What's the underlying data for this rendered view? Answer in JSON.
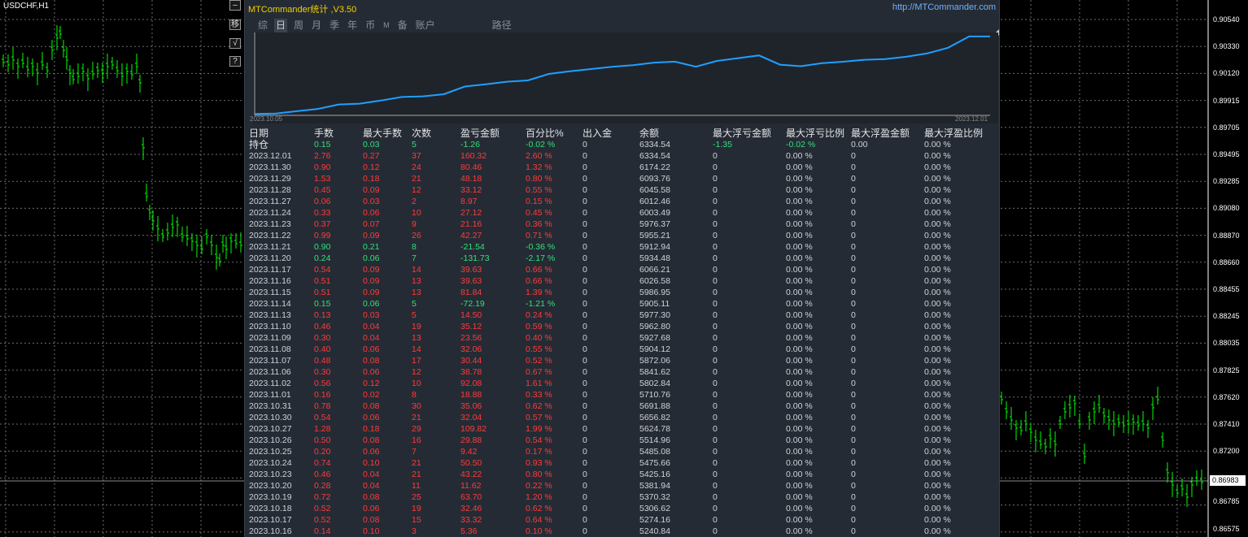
{
  "chart": {
    "symbol": "USDCHF,H1",
    "price_labels": [
      "0.90540",
      "0.90330",
      "0.90120",
      "0.89915",
      "0.89705",
      "0.89495",
      "0.89285",
      "0.89080",
      "0.88870",
      "0.88660",
      "0.88455",
      "0.88245",
      "0.88035",
      "0.87825",
      "0.87620",
      "0.87410",
      "0.87200",
      "0.86983",
      "0.86785",
      "0.86575"
    ],
    "current_price": "0.86983",
    "candle_color": "#00ff00"
  },
  "side_buttons": [
    "–",
    "移",
    "√",
    "?"
  ],
  "panel": {
    "title": "MTCommander统计 ,V3.50",
    "url": "http://MTCommander.com",
    "tabs": [
      {
        "label": "综",
        "active": false
      },
      {
        "label": "日",
        "active": true
      },
      {
        "label": "周",
        "active": false
      },
      {
        "label": "月",
        "active": false
      },
      {
        "label": "季",
        "active": false
      },
      {
        "label": "年",
        "active": false
      },
      {
        "label": "币",
        "active": false
      },
      {
        "label": "M",
        "active": false
      },
      {
        "label": "备",
        "active": false
      },
      {
        "label": "账户",
        "active": false
      },
      {
        "label": "路径",
        "active": false
      }
    ],
    "equity_chart": {
      "start_label": "2023.10.05",
      "end_label": "2023.12.01",
      "line_color": "#1ea0ff"
    },
    "headers": [
      "日期",
      "手数",
      "最大手数",
      "次数",
      "盈亏金额",
      "百分比%",
      "出入金",
      "余额",
      "最大浮亏金额",
      "最大浮亏比例",
      "最大浮盈金额",
      "最大浮盈比例"
    ],
    "holding": {
      "label": "持仓",
      "lots": "0.15",
      "max_lots": "0.03",
      "count": "5",
      "pnl": "-1.26",
      "pct": "-0.02 %",
      "deposit": "0",
      "balance": "6334.54",
      "max_float_loss": "-1.35",
      "max_float_loss_pct": "-0.02 %",
      "max_float_profit": "0.00",
      "max_float_profit_pct": "0.00 %"
    },
    "rows": [
      {
        "date": "2023.12.01",
        "lots": "2.76",
        "max_lots": "0.27",
        "count": "37",
        "pnl": "160.32",
        "pct": "2.60 %",
        "deposit": "0",
        "balance": "6334.54",
        "fl": "0",
        "flp": "0.00 %",
        "fp": "0",
        "fpp": "0.00 %",
        "neg": false
      },
      {
        "date": "2023.11.30",
        "lots": "0.90",
        "max_lots": "0.12",
        "count": "24",
        "pnl": "80.46",
        "pct": "1.32 %",
        "deposit": "0",
        "balance": "6174.22",
        "fl": "0",
        "flp": "0.00 %",
        "fp": "0",
        "fpp": "0.00 %",
        "neg": false
      },
      {
        "date": "2023.11.29",
        "lots": "1.53",
        "max_lots": "0.18",
        "count": "21",
        "pnl": "48.18",
        "pct": "0.80 %",
        "deposit": "0",
        "balance": "6093.76",
        "fl": "0",
        "flp": "0.00 %",
        "fp": "0",
        "fpp": "0.00 %",
        "neg": false
      },
      {
        "date": "2023.11.28",
        "lots": "0.45",
        "max_lots": "0.09",
        "count": "12",
        "pnl": "33.12",
        "pct": "0.55 %",
        "deposit": "0",
        "balance": "6045.58",
        "fl": "0",
        "flp": "0.00 %",
        "fp": "0",
        "fpp": "0.00 %",
        "neg": false
      },
      {
        "date": "2023.11.27",
        "lots": "0.06",
        "max_lots": "0.03",
        "count": "2",
        "pnl": "8.97",
        "pct": "0.15 %",
        "deposit": "0",
        "balance": "6012.46",
        "fl": "0",
        "flp": "0.00 %",
        "fp": "0",
        "fpp": "0.00 %",
        "neg": false
      },
      {
        "date": "2023.11.24",
        "lots": "0.33",
        "max_lots": "0.06",
        "count": "10",
        "pnl": "27.12",
        "pct": "0.45 %",
        "deposit": "0",
        "balance": "6003.49",
        "fl": "0",
        "flp": "0.00 %",
        "fp": "0",
        "fpp": "0.00 %",
        "neg": false
      },
      {
        "date": "2023.11.23",
        "lots": "0.37",
        "max_lots": "0.07",
        "count": "9",
        "pnl": "21.16",
        "pct": "0.36 %",
        "deposit": "0",
        "balance": "5976.37",
        "fl": "0",
        "flp": "0.00 %",
        "fp": "0",
        "fpp": "0.00 %",
        "neg": false
      },
      {
        "date": "2023.11.22",
        "lots": "0.99",
        "max_lots": "0.09",
        "count": "26",
        "pnl": "42.27",
        "pct": "0.71 %",
        "deposit": "0",
        "balance": "5955.21",
        "fl": "0",
        "flp": "0.00 %",
        "fp": "0",
        "fpp": "0.00 %",
        "neg": false
      },
      {
        "date": "2023.11.21",
        "lots": "0.90",
        "max_lots": "0.21",
        "count": "8",
        "pnl": "-21.54",
        "pct": "-0.36 %",
        "deposit": "0",
        "balance": "5912.94",
        "fl": "0",
        "flp": "0.00 %",
        "fp": "0",
        "fpp": "0.00 %",
        "neg": true
      },
      {
        "date": "2023.11.20",
        "lots": "0.24",
        "max_lots": "0.06",
        "count": "7",
        "pnl": "-131.73",
        "pct": "-2.17 %",
        "deposit": "0",
        "balance": "5934.48",
        "fl": "0",
        "flp": "0.00 %",
        "fp": "0",
        "fpp": "0.00 %",
        "neg": true
      },
      {
        "date": "2023.11.17",
        "lots": "0.54",
        "max_lots": "0.09",
        "count": "14",
        "pnl": "39.63",
        "pct": "0.66 %",
        "deposit": "0",
        "balance": "6066.21",
        "fl": "0",
        "flp": "0.00 %",
        "fp": "0",
        "fpp": "0.00 %",
        "neg": false
      },
      {
        "date": "2023.11.16",
        "lots": "0.51",
        "max_lots": "0.09",
        "count": "13",
        "pnl": "39.63",
        "pct": "0.66 %",
        "deposit": "0",
        "balance": "6026.58",
        "fl": "0",
        "flp": "0.00 %",
        "fp": "0",
        "fpp": "0.00 %",
        "neg": false
      },
      {
        "date": "2023.11.15",
        "lots": "0.51",
        "max_lots": "0.09",
        "count": "13",
        "pnl": "81.84",
        "pct": "1.39 %",
        "deposit": "0",
        "balance": "5986.95",
        "fl": "0",
        "flp": "0.00 %",
        "fp": "0",
        "fpp": "0.00 %",
        "neg": false
      },
      {
        "date": "2023.11.14",
        "lots": "0.15",
        "max_lots": "0.06",
        "count": "5",
        "pnl": "-72.19",
        "pct": "-1.21 %",
        "deposit": "0",
        "balance": "5905.11",
        "fl": "0",
        "flp": "0.00 %",
        "fp": "0",
        "fpp": "0.00 %",
        "neg": true
      },
      {
        "date": "2023.11.13",
        "lots": "0.13",
        "max_lots": "0.03",
        "count": "5",
        "pnl": "14.50",
        "pct": "0.24 %",
        "deposit": "0",
        "balance": "5977.30",
        "fl": "0",
        "flp": "0.00 %",
        "fp": "0",
        "fpp": "0.00 %",
        "neg": false
      },
      {
        "date": "2023.11.10",
        "lots": "0.46",
        "max_lots": "0.04",
        "count": "19",
        "pnl": "35.12",
        "pct": "0.59 %",
        "deposit": "0",
        "balance": "5962.80",
        "fl": "0",
        "flp": "0.00 %",
        "fp": "0",
        "fpp": "0.00 %",
        "neg": false
      },
      {
        "date": "2023.11.09",
        "lots": "0.30",
        "max_lots": "0.04",
        "count": "13",
        "pnl": "23.56",
        "pct": "0.40 %",
        "deposit": "0",
        "balance": "5927.68",
        "fl": "0",
        "flp": "0.00 %",
        "fp": "0",
        "fpp": "0.00 %",
        "neg": false
      },
      {
        "date": "2023.11.08",
        "lots": "0.40",
        "max_lots": "0.06",
        "count": "14",
        "pnl": "32.06",
        "pct": "0.55 %",
        "deposit": "0",
        "balance": "5904.12",
        "fl": "0",
        "flp": "0.00 %",
        "fp": "0",
        "fpp": "0.00 %",
        "neg": false
      },
      {
        "date": "2023.11.07",
        "lots": "0.48",
        "max_lots": "0.08",
        "count": "17",
        "pnl": "30.44",
        "pct": "0.52 %",
        "deposit": "0",
        "balance": "5872.06",
        "fl": "0",
        "flp": "0.00 %",
        "fp": "0",
        "fpp": "0.00 %",
        "neg": false
      },
      {
        "date": "2023.11.06",
        "lots": "0.30",
        "max_lots": "0.06",
        "count": "12",
        "pnl": "38.78",
        "pct": "0.67 %",
        "deposit": "0",
        "balance": "5841.62",
        "fl": "0",
        "flp": "0.00 %",
        "fp": "0",
        "fpp": "0.00 %",
        "neg": false
      },
      {
        "date": "2023.11.02",
        "lots": "0.56",
        "max_lots": "0.12",
        "count": "10",
        "pnl": "92.08",
        "pct": "1.61 %",
        "deposit": "0",
        "balance": "5802.84",
        "fl": "0",
        "flp": "0.00 %",
        "fp": "0",
        "fpp": "0.00 %",
        "neg": false
      },
      {
        "date": "2023.11.01",
        "lots": "0.16",
        "max_lots": "0.02",
        "count": "8",
        "pnl": "18.88",
        "pct": "0.33 %",
        "deposit": "0",
        "balance": "5710.76",
        "fl": "0",
        "flp": "0.00 %",
        "fp": "0",
        "fpp": "0.00 %",
        "neg": false
      },
      {
        "date": "2023.10.31",
        "lots": "0.78",
        "max_lots": "0.08",
        "count": "30",
        "pnl": "35.06",
        "pct": "0.62 %",
        "deposit": "0",
        "balance": "5691.88",
        "fl": "0",
        "flp": "0.00 %",
        "fp": "0",
        "fpp": "0.00 %",
        "neg": false
      },
      {
        "date": "2023.10.30",
        "lots": "0.54",
        "max_lots": "0.06",
        "count": "21",
        "pnl": "32.04",
        "pct": "0.57 %",
        "deposit": "0",
        "balance": "5656.82",
        "fl": "0",
        "flp": "0.00 %",
        "fp": "0",
        "fpp": "0.00 %",
        "neg": false
      },
      {
        "date": "2023.10.27",
        "lots": "1.28",
        "max_lots": "0.18",
        "count": "29",
        "pnl": "109.82",
        "pct": "1.99 %",
        "deposit": "0",
        "balance": "5624.78",
        "fl": "0",
        "flp": "0.00 %",
        "fp": "0",
        "fpp": "0.00 %",
        "neg": false
      },
      {
        "date": "2023.10.26",
        "lots": "0.50",
        "max_lots": "0.08",
        "count": "16",
        "pnl": "29.88",
        "pct": "0.54 %",
        "deposit": "0",
        "balance": "5514.96",
        "fl": "0",
        "flp": "0.00 %",
        "fp": "0",
        "fpp": "0.00 %",
        "neg": false
      },
      {
        "date": "2023.10.25",
        "lots": "0.20",
        "max_lots": "0.06",
        "count": "7",
        "pnl": "9.42",
        "pct": "0.17 %",
        "deposit": "0",
        "balance": "5485.08",
        "fl": "0",
        "flp": "0.00 %",
        "fp": "0",
        "fpp": "0.00 %",
        "neg": false
      },
      {
        "date": "2023.10.24",
        "lots": "0.74",
        "max_lots": "0.10",
        "count": "21",
        "pnl": "50.50",
        "pct": "0.93 %",
        "deposit": "0",
        "balance": "5475.66",
        "fl": "0",
        "flp": "0.00 %",
        "fp": "0",
        "fpp": "0.00 %",
        "neg": false
      },
      {
        "date": "2023.10.23",
        "lots": "0.46",
        "max_lots": "0.04",
        "count": "21",
        "pnl": "43.22",
        "pct": "0.80 %",
        "deposit": "0",
        "balance": "5425.16",
        "fl": "0",
        "flp": "0.00 %",
        "fp": "0",
        "fpp": "0.00 %",
        "neg": false
      },
      {
        "date": "2023.10.20",
        "lots": "0.28",
        "max_lots": "0.04",
        "count": "11",
        "pnl": "11.62",
        "pct": "0.22 %",
        "deposit": "0",
        "balance": "5381.94",
        "fl": "0",
        "flp": "0.00 %",
        "fp": "0",
        "fpp": "0.00 %",
        "neg": false
      },
      {
        "date": "2023.10.19",
        "lots": "0.72",
        "max_lots": "0.08",
        "count": "25",
        "pnl": "63.70",
        "pct": "1.20 %",
        "deposit": "0",
        "balance": "5370.32",
        "fl": "0",
        "flp": "0.00 %",
        "fp": "0",
        "fpp": "0.00 %",
        "neg": false
      },
      {
        "date": "2023.10.18",
        "lots": "0.52",
        "max_lots": "0.06",
        "count": "19",
        "pnl": "32.46",
        "pct": "0.62 %",
        "deposit": "0",
        "balance": "5306.62",
        "fl": "0",
        "flp": "0.00 %",
        "fp": "0",
        "fpp": "0.00 %",
        "neg": false
      },
      {
        "date": "2023.10.17",
        "lots": "0.52",
        "max_lots": "0.08",
        "count": "15",
        "pnl": "33.32",
        "pct": "0.64 %",
        "deposit": "0",
        "balance": "5274.16",
        "fl": "0",
        "flp": "0.00 %",
        "fp": "0",
        "fpp": "0.00 %",
        "neg": false
      },
      {
        "date": "2023.10.16",
        "lots": "0.14",
        "max_lots": "0.10",
        "count": "3",
        "pnl": "5.36",
        "pct": "0.10 %",
        "deposit": "0",
        "balance": "5240.84",
        "fl": "0",
        "flp": "0.00 %",
        "fp": "0",
        "fpp": "0.00 %",
        "neg": false
      }
    ]
  }
}
